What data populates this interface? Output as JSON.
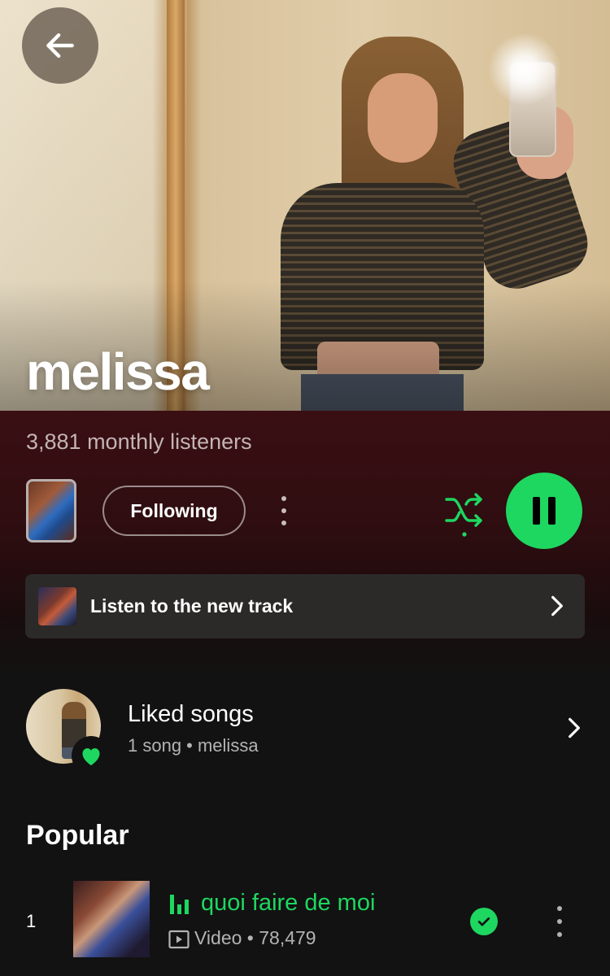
{
  "artist": {
    "name": "melissa",
    "monthly_listeners": "3,881 monthly listeners"
  },
  "actions": {
    "follow_label": "Following"
  },
  "promo": {
    "label": "Listen to the new track"
  },
  "liked": {
    "title": "Liked songs",
    "subtitle": "1 song • melissa"
  },
  "popular": {
    "heading": "Popular",
    "tracks": [
      {
        "rank": "1",
        "title": "quoi faire de moi",
        "meta": "Video • 78,479"
      }
    ]
  },
  "colors": {
    "accent": "#1ed760",
    "band": "#3a0f13",
    "background": "#121212"
  },
  "icons": {
    "back": "arrow-left-icon",
    "more": "more-vertical-icon",
    "shuffle": "shuffle-icon",
    "pause": "pause-icon",
    "chevron": "chevron-right-icon",
    "heart": "heart-icon",
    "equalizer": "equalizer-icon",
    "video": "video-icon",
    "downloaded": "check-circle-icon"
  }
}
